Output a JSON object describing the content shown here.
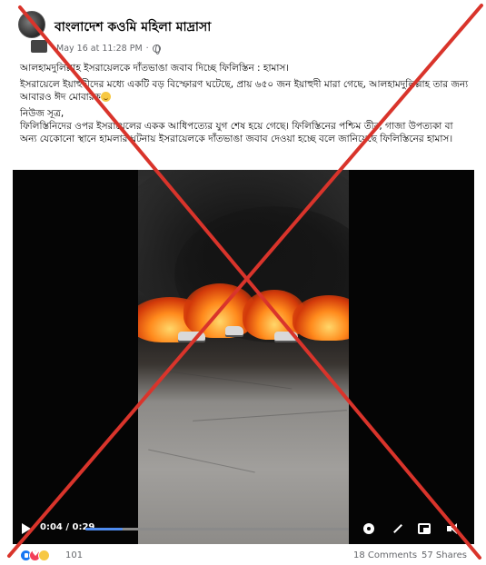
{
  "header": {
    "page_name": "বাংলাদেশ কওমি মহিলা মাদ্রাসা",
    "timestamp": "May 16 at 11:28 PM",
    "separator": "·"
  },
  "post": {
    "paragraphs": [
      "আলহামদুলিল্লাহ ইসরায়েলকে দাঁতভাঙা জবাব দিচ্ছে ফিলিস্তিন : হামাস।",
      "ইসরায়েলে ইয়াহুদীদের মধ্যে একটি বড় বিস্ফোরণ ঘটেছে, প্রায় ৬৫০ জন ইয়াহুদী মারা গেছে, আলহামদুলিল্লাহ তার জন্য আবারও ঈদ মোবারক",
      "নিউজ সূত্র,",
      "ফিলিস্তিনিদের ওপর ইসরায়েলের একক আধিপত্যের যুগ শেষ হয়ে গেছে। ফিলিস্তিনের পশ্চিম তীর, গাজা উপত্যকা বা অন্য যেকোনো স্থানে হামলার ঘটনায় ইসরায়েলকে দাঁতভাঙা জবাব দেওয়া হচ্ছে বলে জানিয়েছে ফিলিস্তিনের হামাস।"
    ]
  },
  "video": {
    "time": "0:04 / 0:29",
    "progress_fraction": 0.14,
    "icons": [
      "play-icon",
      "gear-icon",
      "expand-icon",
      "pip-icon",
      "volume-icon"
    ]
  },
  "footer": {
    "reaction_count": "101",
    "comments": "18 Comments",
    "shares": "57 Shares",
    "reaction_icons": [
      "like-icon",
      "love-icon",
      "sad-icon"
    ]
  },
  "colors": {
    "x_overlay": "#d9342b",
    "progress": "#4f8cf0",
    "meta_text": "#65676b"
  }
}
